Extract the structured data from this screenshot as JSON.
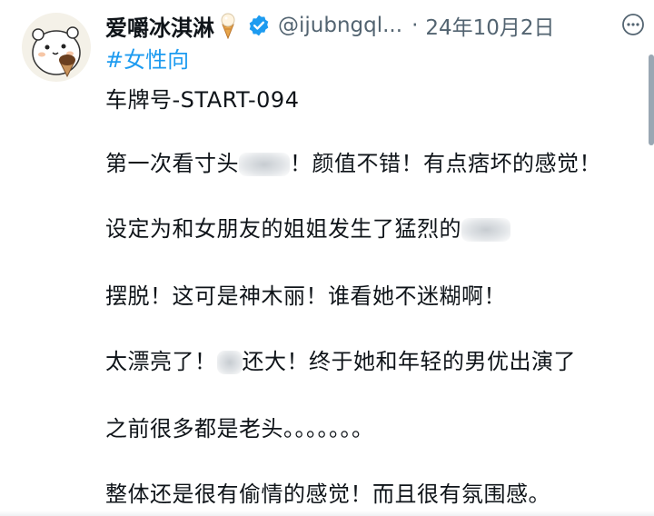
{
  "author": {
    "name": "爱嚼冰淇淋",
    "handle": "@ijubngql...",
    "separator": "·",
    "date": "24年10月2日"
  },
  "hashtag": "#女性向",
  "lines": [
    {
      "before": "车牌号-START-094",
      "after": ""
    },
    {
      "before": "第一次看寸头",
      "after": "！颜值不错！有点痞坏的感觉！"
    },
    {
      "before": "设定为和女朋友的姐姐发生了猛烈的",
      "after": ""
    },
    {
      "before": "摆脱！这可是神木丽！谁看她不迷糊啊！",
      "after": ""
    },
    {
      "before": "太漂亮了！",
      "after": "还大！终于她和年轻的男优出演了"
    },
    {
      "before": "之前很多都是老头。。。。。。。",
      "after": ""
    },
    {
      "before": "整体还是很有偷情的感觉！而且很有氛围感。",
      "after": ""
    }
  ],
  "colors": {
    "accent": "#1d9bf0",
    "text": "#0f1419",
    "muted": "#536471"
  },
  "icons": {
    "verified": "verified-badge-icon",
    "more": "more-options-icon",
    "emoji": "ice-cream-emoji-icon"
  }
}
